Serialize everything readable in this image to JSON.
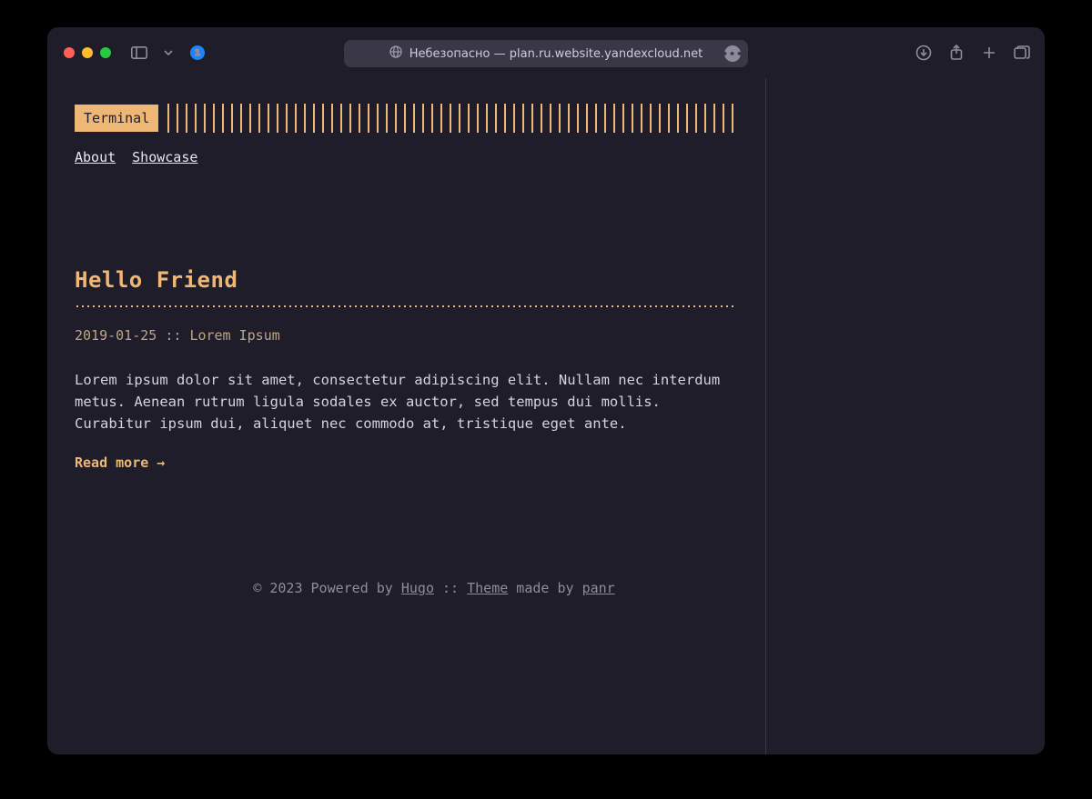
{
  "browser": {
    "address_text": "Небезопасно — plan.ru.website.yandexcloud.net"
  },
  "site": {
    "logo_label": "Terminal",
    "nav": {
      "about": "About",
      "showcase": "Showcase"
    }
  },
  "post": {
    "title": "Hello Friend",
    "date": "2019-01-25",
    "sep": "::",
    "author": "Lorem Ipsum",
    "excerpt": "Lorem ipsum dolor sit amet, consectetur adipiscing elit. Nullam nec interdum metus. Aenean rutrum ligula sodales ex auctor, sed tempus dui mollis. Curabitur ipsum dui, aliquet nec commodo at, tristique eget ante.",
    "read_more": "Read more →"
  },
  "footer": {
    "copyright_prefix": "© 2023 Powered by ",
    "hugo": "Hugo",
    "sep": " :: ",
    "theme": "Theme",
    "made_by": " made by ",
    "panr": "panr"
  }
}
